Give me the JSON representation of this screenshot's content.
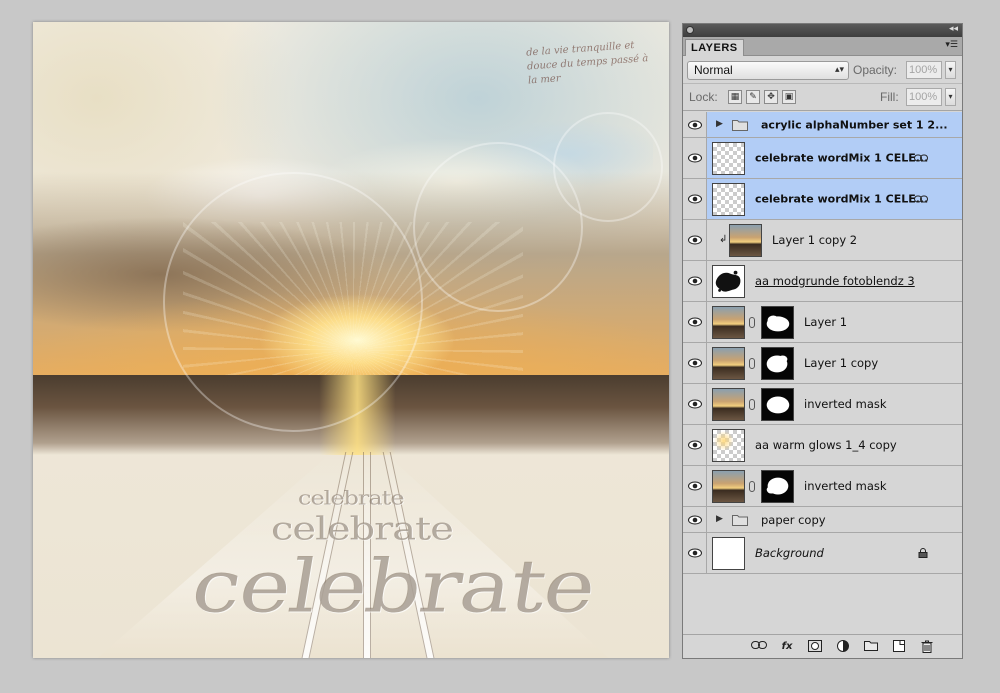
{
  "canvas": {
    "script_text": "de la vie tranquille et douce du temps passé à la mer",
    "word_large": "celebrate",
    "word_medium": "celebrate",
    "word_small": "celebrate"
  },
  "panel": {
    "tab_label": "LAYERS",
    "blend_mode": "Normal",
    "opacity_label": "Opacity:",
    "opacity_value": "100%",
    "lock_label": "Lock:",
    "fill_label": "Fill:",
    "fill_value": "100%"
  },
  "layers": [
    {
      "name": "acrylic alphaNumber set 1 2...",
      "type": "group"
    },
    {
      "name": "celebrate wordMix 1 CELE...",
      "type": "layer"
    },
    {
      "name": "celebrate wordMix 1 CELE...",
      "type": "layer"
    },
    {
      "name": "Layer 1 copy 2",
      "type": "clipped"
    },
    {
      "name": "aa modgrunde fotoblendz 3",
      "type": "layer"
    },
    {
      "name": "Layer 1",
      "type": "masked"
    },
    {
      "name": "Layer 1 copy",
      "type": "masked"
    },
    {
      "name": "inverted mask",
      "type": "masked"
    },
    {
      "name": "aa warm glows 1_4 copy",
      "type": "layer"
    },
    {
      "name": "inverted mask",
      "type": "masked"
    },
    {
      "name": "paper copy",
      "type": "group"
    },
    {
      "name": "Background",
      "type": "background"
    }
  ],
  "icons": {
    "eye": "eye-icon",
    "link": "link-icon",
    "fx": "fx",
    "lock": "lock-icon"
  },
  "footer": {
    "fx_label": "fx"
  }
}
